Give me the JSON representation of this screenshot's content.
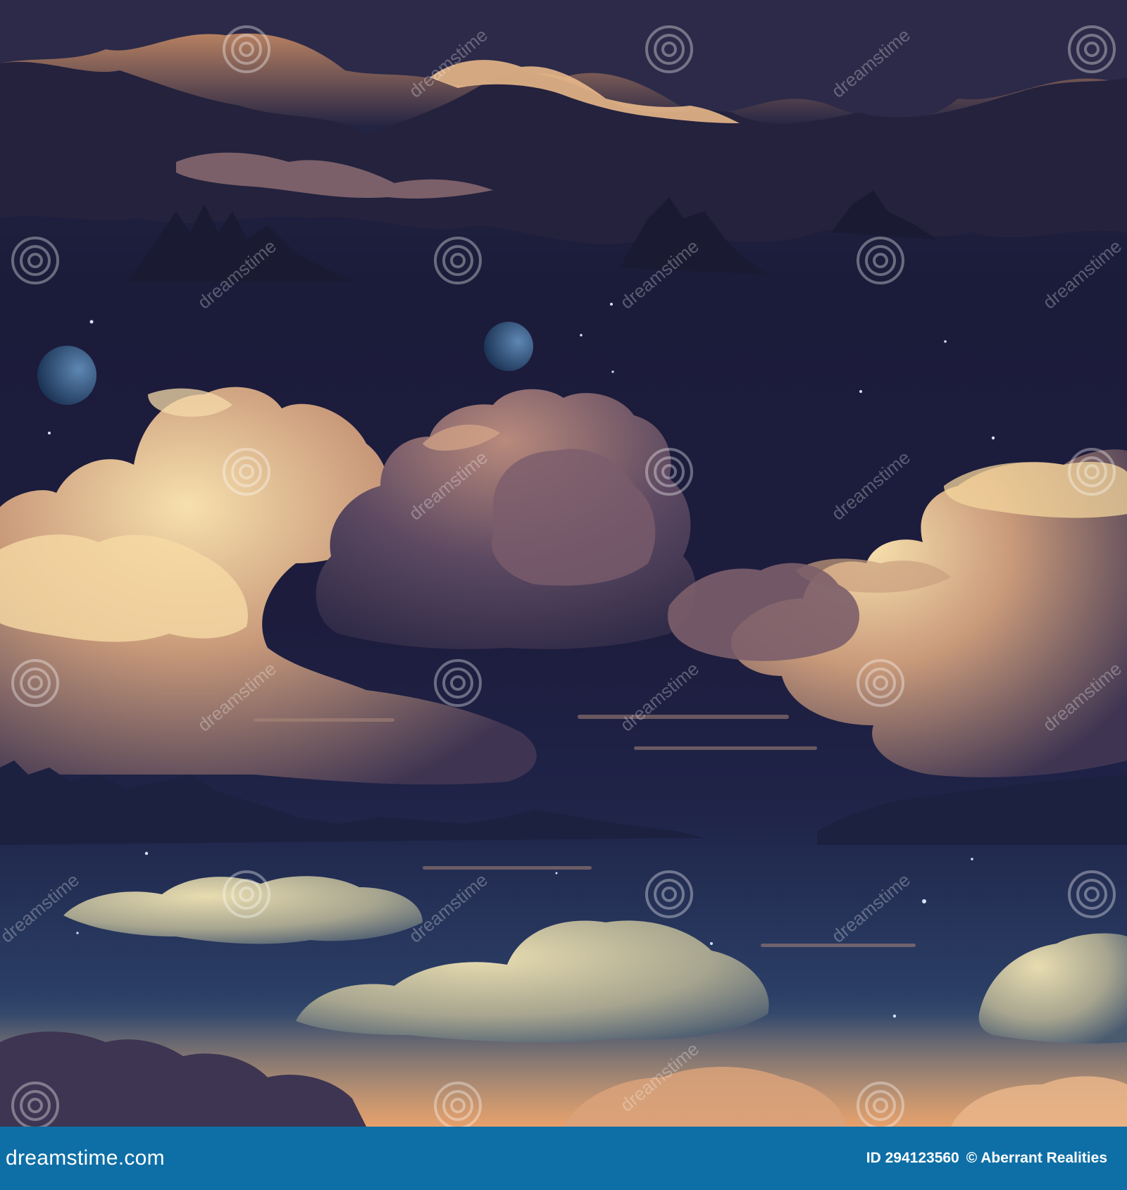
{
  "image": {
    "description_alt": "",
    "palette": {
      "sky_top": "#1a1d3f",
      "sky_mid": "#1b1c3c",
      "sky_low": "#263461",
      "horizon_glow": "#f0a56a",
      "cloud_light": "#f3d6a3",
      "cloud_shadow": "#3e3552",
      "moon": "#2c4f7b"
    }
  },
  "watermark": {
    "text": "dreamstime",
    "icon": "spiral-watermark-icon"
  },
  "footer": {
    "site": "dreamstime.com",
    "id_label": "ID 294123560",
    "credit": "© Aberrant Realities",
    "color": "#0e6fa6"
  }
}
